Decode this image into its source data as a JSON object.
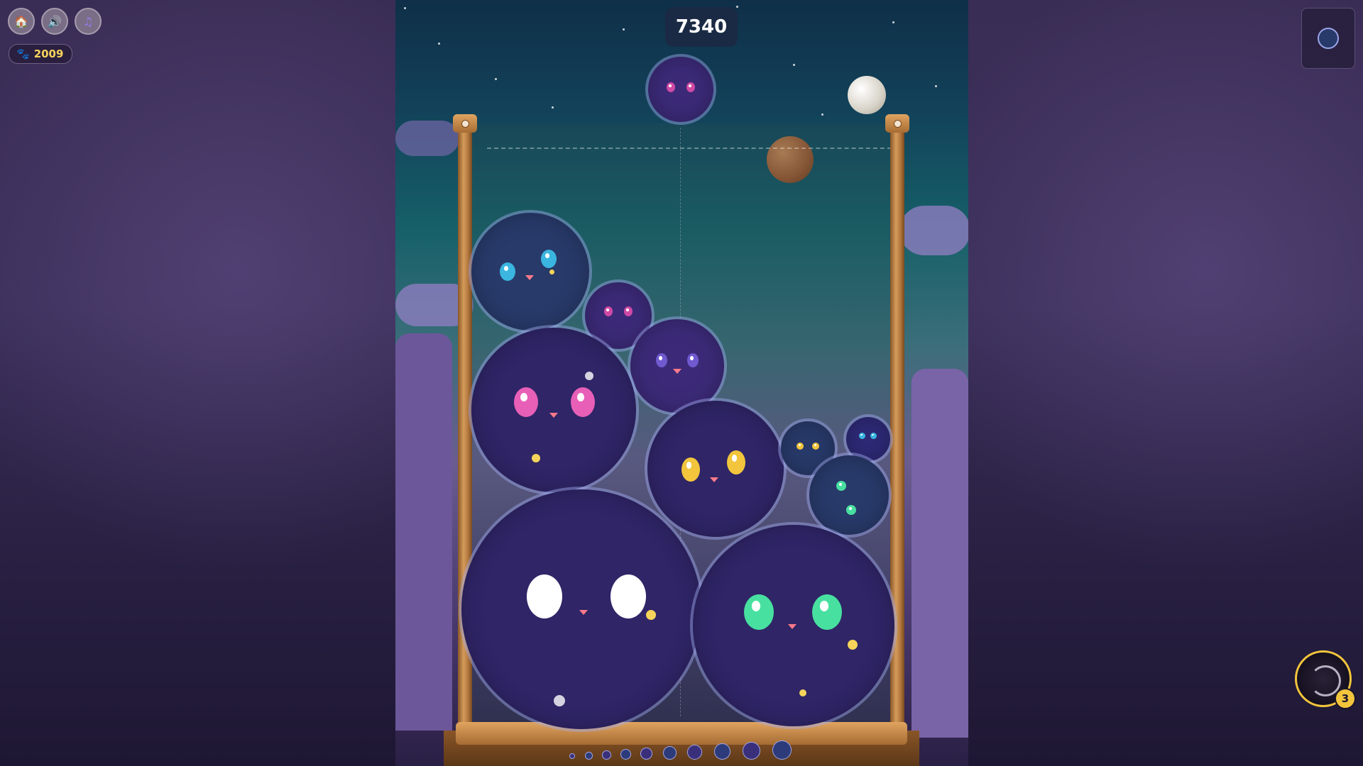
{
  "hud": {
    "score": "7340",
    "coins": "2009",
    "power_count": "3"
  },
  "controls": {
    "home_icon": "home-icon",
    "sound_icon": "speaker-icon",
    "music_icon": "music-note-icon"
  },
  "colors": {
    "frame_wood": "#c98a48",
    "score_bg": "#1a2a44",
    "coin_text": "#f6d35a",
    "cat_body": "#2f2567",
    "accent_gold": "#f2c53d"
  }
}
